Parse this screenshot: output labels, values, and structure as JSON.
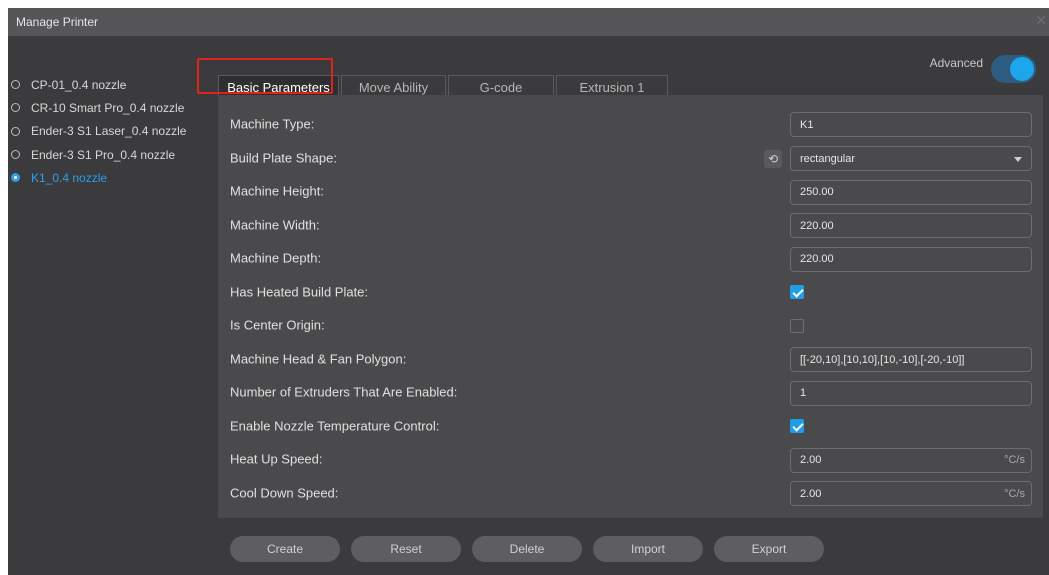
{
  "window": {
    "title": "Manage Printer"
  },
  "printers": [
    {
      "label": "CP-01_0.4 nozzle",
      "selected": false
    },
    {
      "label": "CR-10 Smart Pro_0.4 nozzle",
      "selected": false
    },
    {
      "label": "Ender-3 S1 Laser_0.4 nozzle",
      "selected": false
    },
    {
      "label": "Ender-3 S1 Pro_0.4 nozzle",
      "selected": false
    },
    {
      "label": "K1_0.4 nozzle",
      "selected": true
    }
  ],
  "advanced": {
    "label": "Advanced",
    "enabled": true
  },
  "tabs": [
    {
      "label": "Basic Parameters",
      "active": true
    },
    {
      "label": "Move Ability",
      "active": false
    },
    {
      "label": "G-code",
      "active": false
    },
    {
      "label": "Extrusion 1",
      "active": false
    }
  ],
  "params": {
    "machine_type": {
      "label": "Machine Type:",
      "value": "K1"
    },
    "build_plate_shape": {
      "label": "Build Plate Shape:",
      "value": "rectangular"
    },
    "machine_height": {
      "label": "Machine Height:",
      "value": "250.00"
    },
    "machine_width": {
      "label": "Machine Width:",
      "value": "220.00"
    },
    "machine_depth": {
      "label": "Machine Depth:",
      "value": "220.00"
    },
    "heated_build_plate": {
      "label": "Has Heated Build Plate:",
      "checked": true
    },
    "center_origin": {
      "label": "Is Center Origin:",
      "checked": false
    },
    "head_fan_polygon": {
      "label": "Machine Head & Fan Polygon:",
      "value": "[[-20,10],[10,10],[10,-10],[-20,-10]]"
    },
    "extruders_enabled": {
      "label": "Number of Extruders That Are Enabled:",
      "value": "1"
    },
    "nozzle_temp_control": {
      "label": "Enable Nozzle Temperature Control:",
      "checked": true
    },
    "heat_up_speed": {
      "label": "Heat Up Speed:",
      "value": "2.00",
      "unit": "°C/s"
    },
    "cool_down_speed": {
      "label": "Cool Down Speed:",
      "value": "2.00",
      "unit": "°C/s"
    }
  },
  "buttons": {
    "create": "Create",
    "reset": "Reset",
    "delete": "Delete",
    "import": "Import",
    "export": "Export"
  },
  "icons": {
    "close": "close-icon",
    "reset_default": "reset-icon",
    "dropdown": "chevron-down-icon"
  },
  "colors": {
    "accent": "#1e9de8",
    "selected_printer": "#2c9fe6",
    "highlight_box": "#e0221b"
  }
}
